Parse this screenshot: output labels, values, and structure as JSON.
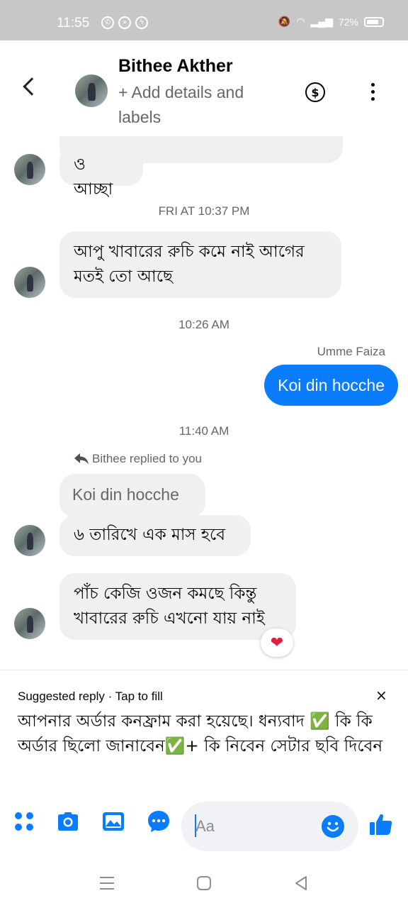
{
  "status_bar": {
    "time": "11:55",
    "battery": "72%"
  },
  "header": {
    "name": "Bithee Akther",
    "subtitle": "+ Add details and labels",
    "dollar_icon": "$"
  },
  "messages": {
    "m1": "ও আচ্ছা",
    "ts1": "FRI AT 10:37 PM",
    "m2_line1": "আপু খাবারের রুচি কমে নাই আগের",
    "m2_line2": "মতই তো আছে",
    "ts2": "10:26 AM",
    "sender": "Umme Faiza",
    "out1": "Koi din hocche",
    "ts3": "11:40 AM",
    "replied_label": "Bithee replied to you",
    "quoted": "Koi din hocche",
    "m3": "৬ তারিখে এক মাস হবে",
    "m4_line1": "পাঁচ কেজি ওজন কমছে কিন্তু",
    "m4_line2": "খাবারের রুচি এখনো যায় নাই",
    "reaction": "❤"
  },
  "suggested": {
    "label": "Suggested reply · Tap to fill",
    "close": "×",
    "text": "আপনার অর্ডার কনফ্রাম করা হয়েছে। ধন্যবাদ ✅ কি কি অর্ডার ছিলো জানাবেন✅+ কি নিবেন সেটার ছবি দিবেন"
  },
  "composer": {
    "placeholder": "Aa"
  },
  "colors": {
    "accent": "#0a7cff",
    "bubble": "#f0f0f0",
    "muted": "#65676b"
  }
}
